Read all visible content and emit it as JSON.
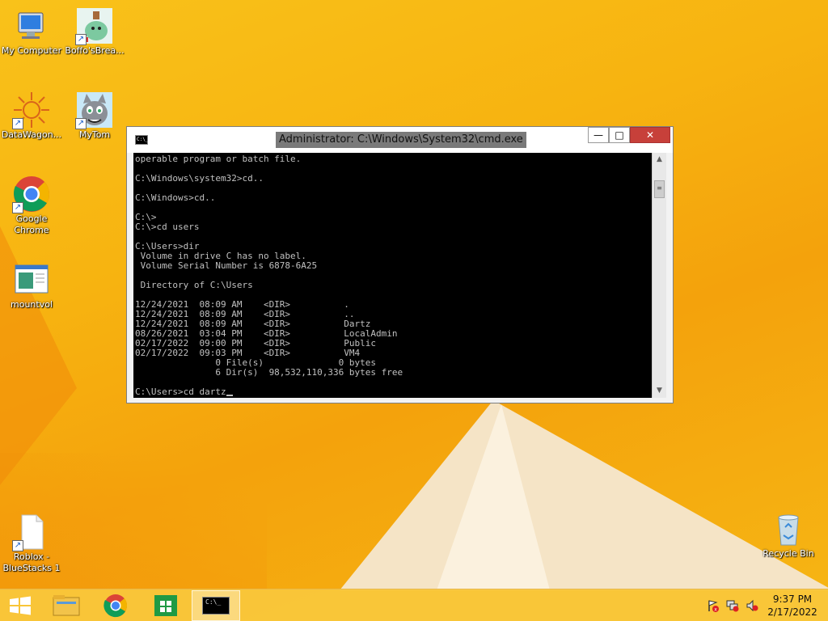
{
  "desktop": {
    "icons": [
      {
        "label": "My Computer"
      },
      {
        "label": "Boffo'sBrea..."
      },
      {
        "label": "DataWagon..."
      },
      {
        "label": "MyTom"
      },
      {
        "label": "Google Chrome"
      },
      {
        "label": "mountvol"
      },
      {
        "label": "Roblox - BlueStacks 1"
      },
      {
        "label": "Recycle Bin"
      }
    ]
  },
  "cmd_window": {
    "title": "Administrator: C:\\Windows\\System32\\cmd.exe",
    "sysicon_text": "C:\\_",
    "buttons": {
      "minimize": "—",
      "maximize": "□",
      "close": "✕"
    },
    "console_lines": [
      "operable program or batch file.",
      "",
      "C:\\Windows\\system32>cd..",
      "",
      "C:\\Windows>cd..",
      "",
      "C:\\>",
      "C:\\>cd users",
      "",
      "C:\\Users>dir",
      " Volume in drive C has no label.",
      " Volume Serial Number is 6878-6A25",
      "",
      " Directory of C:\\Users",
      "",
      "12/24/2021  08:09 AM    <DIR>          .",
      "12/24/2021  08:09 AM    <DIR>          ..",
      "12/24/2021  08:09 AM    <DIR>          Dartz",
      "08/26/2021  03:04 PM    <DIR>          LocalAdmin",
      "02/17/2022  09:00 PM    <DIR>          Public",
      "02/17/2022  09:03 PM    <DIR>          VM4",
      "               0 File(s)              0 bytes",
      "               6 Dir(s)  98,532,110,336 bytes free",
      ""
    ],
    "prompt_line": "C:\\Users>cd dartz"
  },
  "taskbar": {
    "clock_time": "9:37 PM",
    "clock_date": "2/17/2022",
    "cmd_icon_text": "C:\\_"
  }
}
